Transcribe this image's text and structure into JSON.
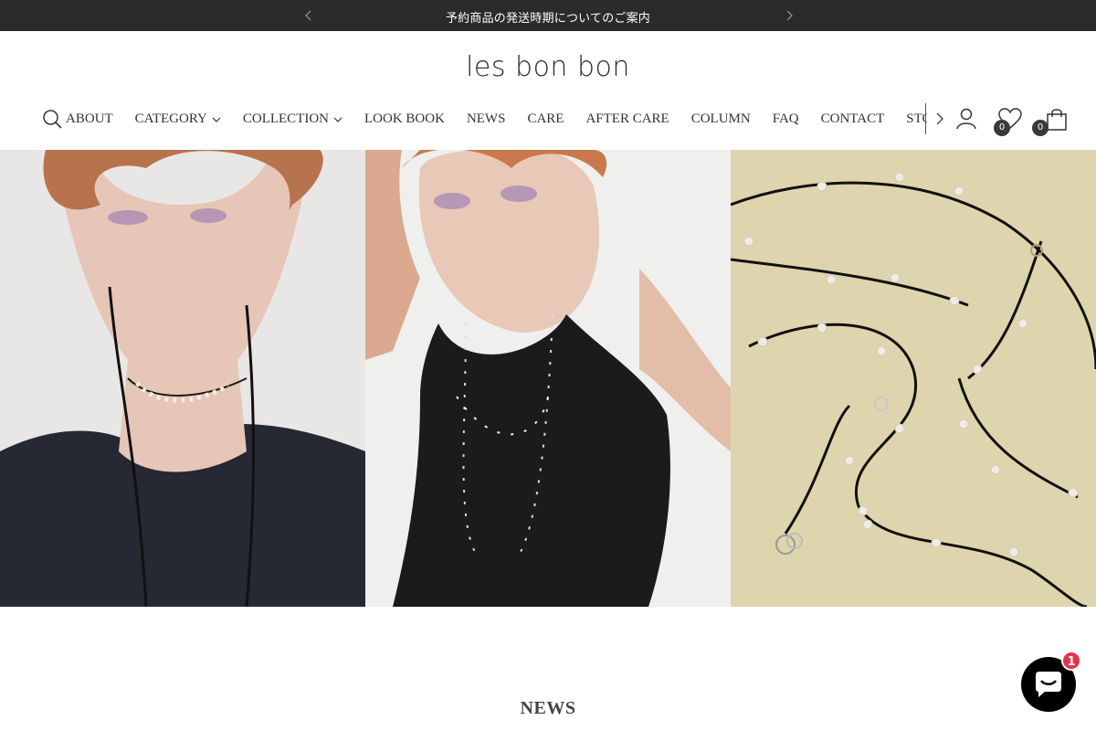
{
  "announcement": {
    "text": "予約商品の発送時期についてのご案内"
  },
  "brand": {
    "logo": "les bon bon"
  },
  "nav": {
    "items": [
      {
        "label": "ABOUT",
        "dropdown": false
      },
      {
        "label": "CATEGORY",
        "dropdown": true
      },
      {
        "label": "COLLECTION",
        "dropdown": true
      },
      {
        "label": "LOOK BOOK",
        "dropdown": false
      },
      {
        "label": "NEWS",
        "dropdown": false
      },
      {
        "label": "CARE",
        "dropdown": false
      },
      {
        "label": "AFTER CARE",
        "dropdown": false
      },
      {
        "label": "COLUMN",
        "dropdown": false
      },
      {
        "label": "FAQ",
        "dropdown": false
      },
      {
        "label": "CONTACT",
        "dropdown": false
      },
      {
        "label": "STOCK",
        "dropdown": false
      }
    ]
  },
  "header_icons": {
    "search": "search-icon",
    "account": "user-icon",
    "wishlist": "heart-icon",
    "cart": "bag-icon"
  },
  "counts": {
    "wishlist": "0",
    "cart": "0"
  },
  "hero": {
    "panels": [
      "model-necklace-portrait",
      "model-black-top-pearl-chain",
      "pearl-chain-on-beige"
    ]
  },
  "section": {
    "title": "NEWS"
  },
  "chat": {
    "unread": "1"
  },
  "colors": {
    "announcement_bg": "#2b2b2b",
    "badge_bg": "#3a3a3a",
    "chat_badge": "#e0334b",
    "hero_beige": "#ddd3ad"
  }
}
